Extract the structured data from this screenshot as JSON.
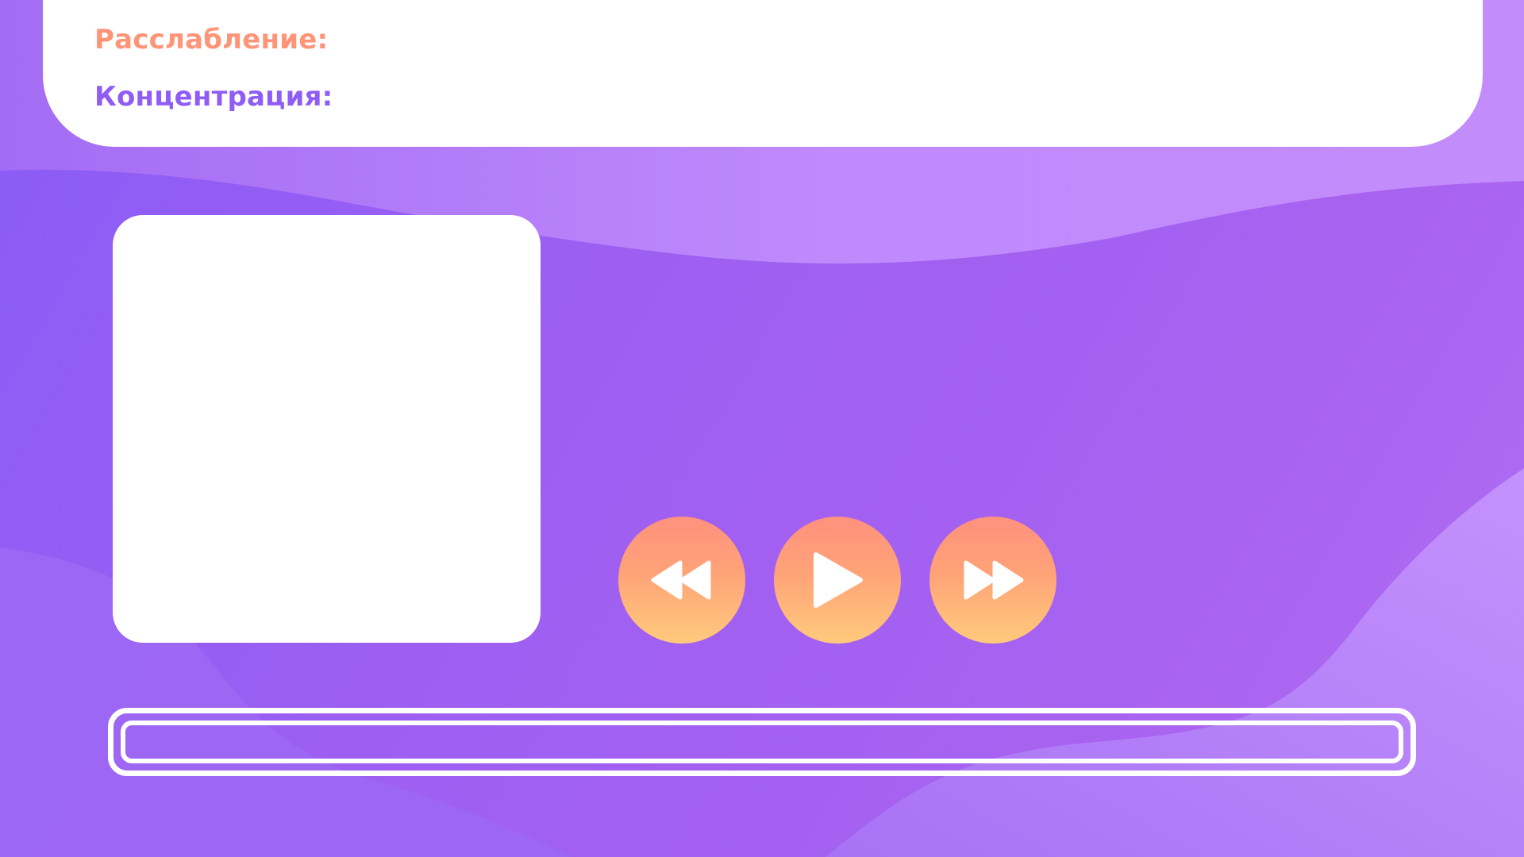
{
  "info": {
    "relaxation_label": "Расслабление:",
    "concentration_label": "Концентрация:"
  },
  "controls": {
    "rewind_icon": "rewind-icon",
    "play_icon": "play-icon",
    "forward_icon": "fast-forward-icon"
  },
  "progress": {
    "value": 0
  },
  "colors": {
    "relaxation_text": "#ff9478",
    "concentration_text": "#8f5cf5",
    "background_purple": "#9d5ff2",
    "button_gradient_top": "#ff917d",
    "button_gradient_bottom": "#ffca7c"
  }
}
